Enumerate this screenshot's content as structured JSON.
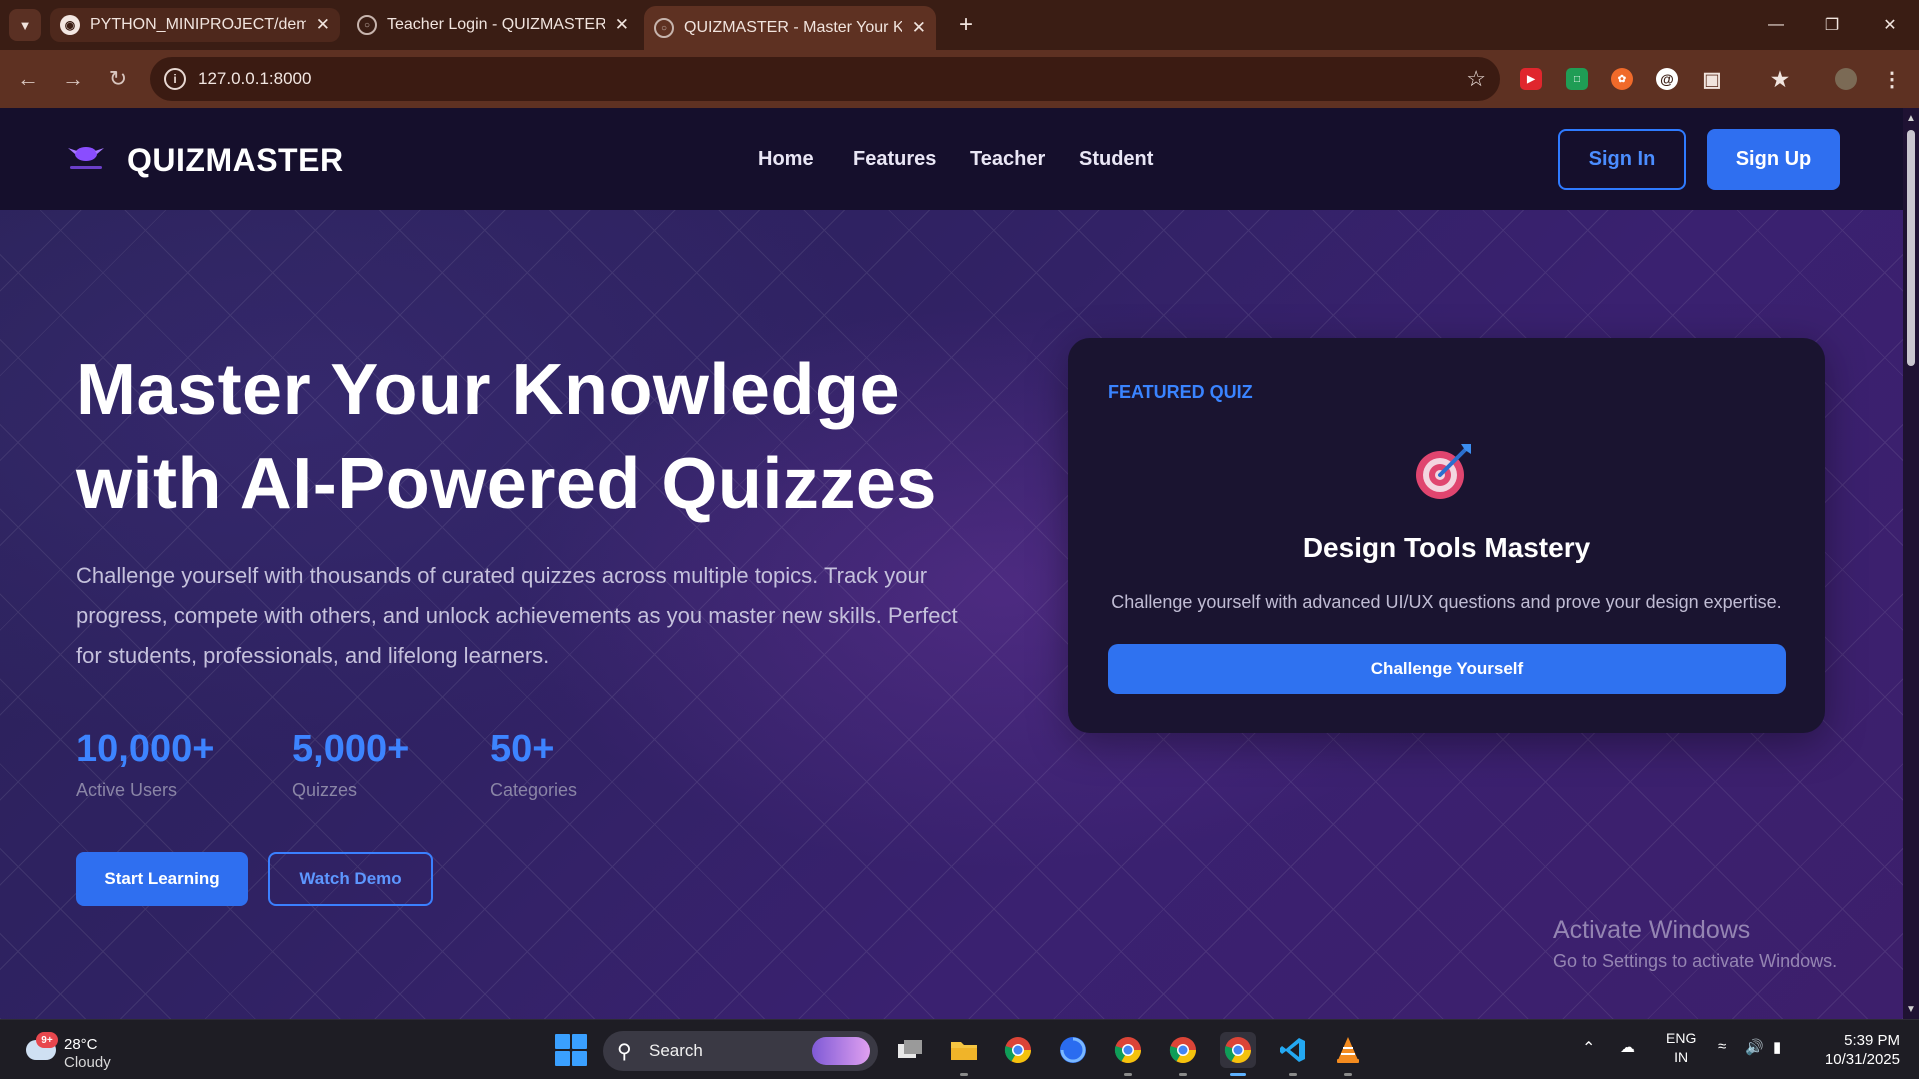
{
  "browser": {
    "tabs": [
      {
        "title": "PYTHON_MINIPROJECT/demo_",
        "favicon": "github-icon"
      },
      {
        "title": "Teacher Login - QUIZMASTER",
        "favicon": "globe-icon"
      },
      {
        "title": "QUIZMASTER - Master Your Kn",
        "favicon": "globe-icon",
        "active": true
      }
    ],
    "url": "127.0.0.1:8000"
  },
  "site": {
    "brand": "QUIZMASTER",
    "nav": [
      "Home",
      "Features",
      "Teacher",
      "Student"
    ],
    "signin_label": "Sign In",
    "signup_label": "Sign Up"
  },
  "hero": {
    "title_line1": "Master Your Knowledge",
    "title_line2": "with AI-Powered Quizzes",
    "description": "Challenge yourself with thousands of curated quizzes across multiple topics. Track your progress, compete with others, and unlock achievements as you master new skills. Perfect for students, professionals, and lifelong learners.",
    "stats": [
      {
        "value": "10,000+",
        "label": "Active Users"
      },
      {
        "value": "5,000+",
        "label": "Quizzes"
      },
      {
        "value": "50+",
        "label": "Categories"
      }
    ],
    "start_label": "Start Learning",
    "demo_label": "Watch Demo"
  },
  "featured": {
    "tag": "FEATURED QUIZ",
    "icon": "target-icon",
    "title": "Design Tools Mastery",
    "description": "Challenge yourself with advanced UI/UX questions and prove your design expertise.",
    "button_label": "Challenge Yourself"
  },
  "watermark": {
    "line1": "Activate Windows",
    "line2": "Go to Settings to activate Windows."
  },
  "taskbar": {
    "weather_badge": "9+",
    "temperature": "28°C",
    "condition": "Cloudy",
    "search_label": "Search",
    "language_line1": "ENG",
    "language_line2": "IN",
    "time": "5:39 PM",
    "date": "10/31/2025"
  },
  "colors": {
    "accent": "#2f6ff0",
    "accent_text": "#3d84ff",
    "browser_frame": "#5e3122",
    "site_header": "#150f2c"
  }
}
